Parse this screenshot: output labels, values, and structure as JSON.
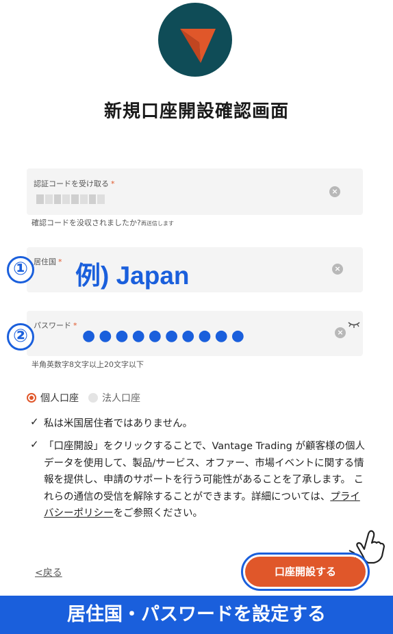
{
  "brand": {
    "logo": "vantage-arrow-logo",
    "colors": {
      "logo_bg": "#0f4c57",
      "accent": "#e0572a",
      "highlight": "#1a5fdc"
    }
  },
  "page_title": "新規口座開設確認画面",
  "code_field": {
    "label": "認証コードを受け取る",
    "required": "*",
    "clear_icon": "close-circle-icon"
  },
  "code_hint": {
    "text": "確認コードを没収されましたか?",
    "resend": "再送信します"
  },
  "country_field": {
    "label": "居住国",
    "required": "*",
    "example": "例) Japan"
  },
  "password_field": {
    "label": "パスワード",
    "required": "*",
    "value_mask": "●●●●●●●●●●",
    "toggle_icon": "eye-closed-icon"
  },
  "password_hint": "半角英数字8文字以上20文字以下",
  "steps": {
    "one": "①",
    "two": "②"
  },
  "account_type": {
    "individual": "個人口座",
    "corporate": "法人口座",
    "selected": "個人口座"
  },
  "checks": {
    "us_resident": "私は米国居住者ではありません。",
    "consent_before": "「口座開設」をクリックすることで、Vantage Trading が顧客様の個人データを使用して、製品/サービス、オファー、市場イベントに関する情報を提供し、申請のサポートを行う可能性があることを了承します。 これらの通信の受信を解除することができます。詳細については、",
    "consent_link": "プライバシーポリシー",
    "consent_after": "をご参照ください。"
  },
  "back_label": "<戻る",
  "submit_label": "口座開設する",
  "banner": "居住国・パスワードを設定する"
}
